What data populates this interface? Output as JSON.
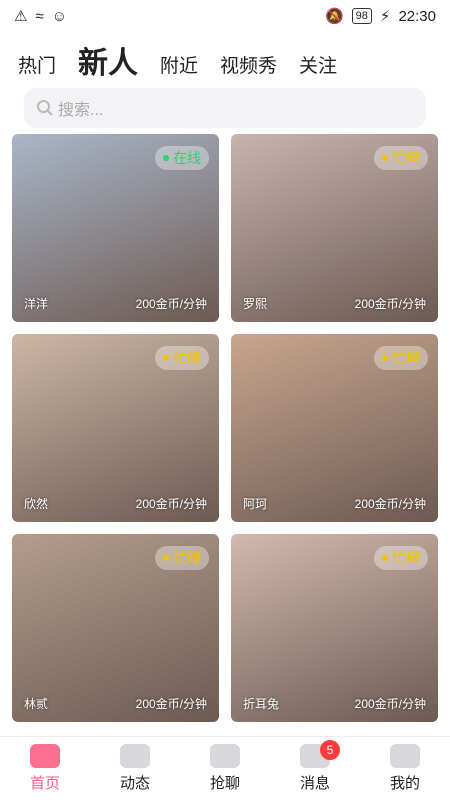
{
  "status_bar": {
    "time": "22:30",
    "battery": "98",
    "icons": [
      "alert-icon",
      "wifi-icon",
      "app-icon",
      "mute-icon",
      "charging-icon"
    ]
  },
  "tabs": [
    {
      "label": "热门",
      "active": false
    },
    {
      "label": "新人",
      "active": true
    },
    {
      "label": "附近",
      "active": false
    },
    {
      "label": "视频秀",
      "active": false
    },
    {
      "label": "关注",
      "active": false
    }
  ],
  "search": {
    "placeholder": "搜索..."
  },
  "cards": [
    {
      "name": "洋洋",
      "price": "200金币/分钟",
      "status": "在线",
      "status_type": "online",
      "bg": "#a9b6c8"
    },
    {
      "name": "罗熙",
      "price": "200金币/分钟",
      "status": "忙碌",
      "status_type": "busy",
      "bg": "#c9b3b0"
    },
    {
      "name": "欣然",
      "price": "200金币/分钟",
      "status": "忙碌",
      "status_type": "busy",
      "bg": "#cdb6a4"
    },
    {
      "name": "阿珂",
      "price": "200金币/分钟",
      "status": "忙碌",
      "status_type": "busy",
      "bg": "#c8a68e"
    },
    {
      "name": "林贰",
      "price": "200金币/分钟",
      "status": "忙碌",
      "status_type": "busy",
      "bg": "#b49d8c"
    },
    {
      "name": "折耳兔",
      "price": "200金币/分钟",
      "status": "忙碌",
      "status_type": "busy",
      "bg": "#d2b9ae"
    }
  ],
  "bottom_nav": [
    {
      "label": "首页",
      "active": true,
      "icon": "pig-home-icon"
    },
    {
      "label": "动态",
      "active": false,
      "icon": "tv-icon"
    },
    {
      "label": "抢聊",
      "active": false,
      "icon": "chart-icon"
    },
    {
      "label": "消息",
      "active": false,
      "icon": "message-icon",
      "count": "5"
    },
    {
      "label": "我的",
      "active": false,
      "icon": "profile-icon"
    }
  ],
  "colors": {
    "accent": "#ff5b7e",
    "online": "#2fd36a",
    "busy": "#f0c400"
  }
}
